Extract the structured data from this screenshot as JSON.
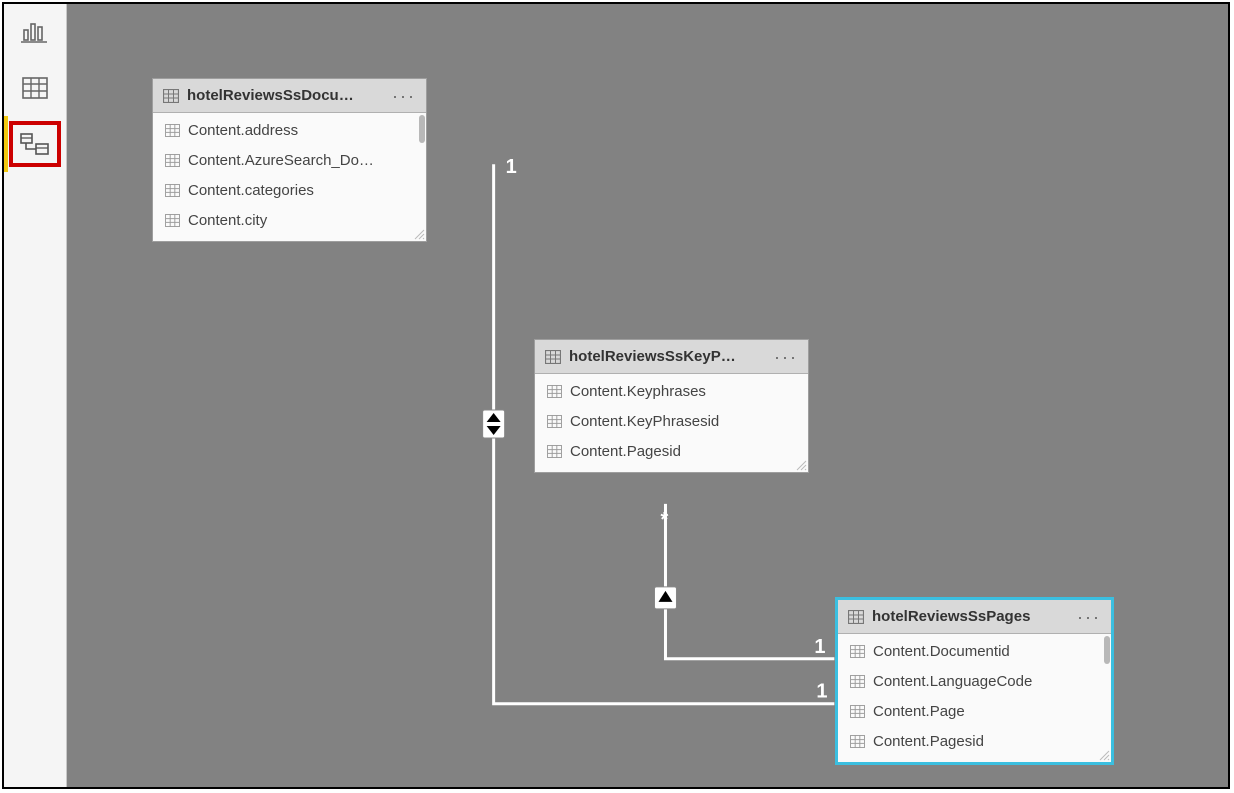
{
  "nav": {
    "report": "Report view",
    "data": "Data view",
    "model": "Model view"
  },
  "tables": {
    "docu": {
      "title": "hotelReviewsSsDocu…",
      "fields": [
        "Content.address",
        "Content.AzureSearch_Do…",
        "Content.categories",
        "Content.city"
      ]
    },
    "keyp": {
      "title": "hotelReviewsSsKeyP…",
      "fields": [
        "Content.Keyphrases",
        "Content.KeyPhrasesid",
        "Content.Pagesid"
      ]
    },
    "pages": {
      "title": "hotelReviewsSsPages",
      "fields": [
        "Content.Documentid",
        "Content.LanguageCode",
        "Content.Page",
        "Content.Pagesid"
      ]
    }
  },
  "relations": {
    "docu_to_pages": {
      "from_card": "1",
      "to_card": "1"
    },
    "pages_to_keyp": {
      "from_card": "1",
      "to_card": "*"
    }
  }
}
